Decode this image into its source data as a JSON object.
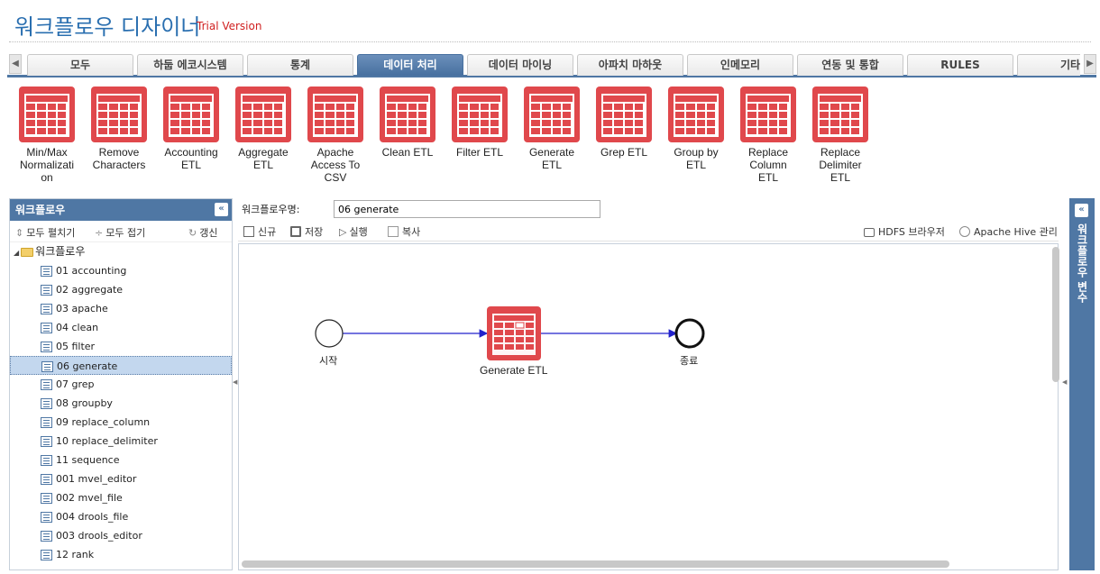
{
  "header": {
    "title": "워크플로우 디자이너",
    "subtitle": "Trial Version"
  },
  "tabs": {
    "prev_icon": "arrow-left-icon",
    "next_icon": "arrow-right-icon",
    "items": [
      "모두",
      "하둡 에코시스템",
      "통계",
      "데이터 처리",
      "데이터 마이닝",
      "아파치 마하웃",
      "인메모리",
      "연동 및 통합",
      "RULES",
      "기타"
    ],
    "active": "데이터 처리"
  },
  "palette": {
    "icon": "table-grid-icon",
    "icon_color": "#e0484c",
    "items": [
      "Min/Max\nNormalizati\non",
      "Remove\nCharacters",
      "Accounting\nETL",
      "Aggregate\nETL",
      "Apache\nAccess To\nCSV",
      "Clean ETL",
      "Filter ETL",
      "Generate\nETL",
      "Grep ETL",
      "Group by\nETL",
      "Replace\nColumn\nETL",
      "Replace\nDelimiter\nETL"
    ]
  },
  "left_panel": {
    "title": "워크플로우",
    "expand_all": "모두 펼치기",
    "collapse_all": "모두 접기",
    "refresh": "갱신",
    "root": "워크플로우",
    "items": [
      "01 accounting",
      "02 aggregate",
      "03 apache",
      "04 clean",
      "05 filter",
      "06 generate",
      "07 grep",
      "08 groupby",
      "09 replace_column",
      "10 replace_delimiter",
      "11 sequence",
      "001 mvel_editor",
      "002 mvel_file",
      "004 drools_file",
      "003 drools_editor",
      "12 rank"
    ],
    "selected": "06 generate"
  },
  "editor": {
    "name_label": "워크플로우명:",
    "name_value": "06 generate",
    "new": "신규",
    "save": "저장",
    "run": "실행",
    "copy": "복사",
    "hdfs": "HDFS 브라우저",
    "hive": "Apache Hive 관리"
  },
  "diagram": {
    "start_label": "시작",
    "node_label": "Generate ETL",
    "end_label": "종료",
    "edge_color": "#2222cc"
  },
  "right_panel": {
    "title": "워크플로우 변수"
  }
}
